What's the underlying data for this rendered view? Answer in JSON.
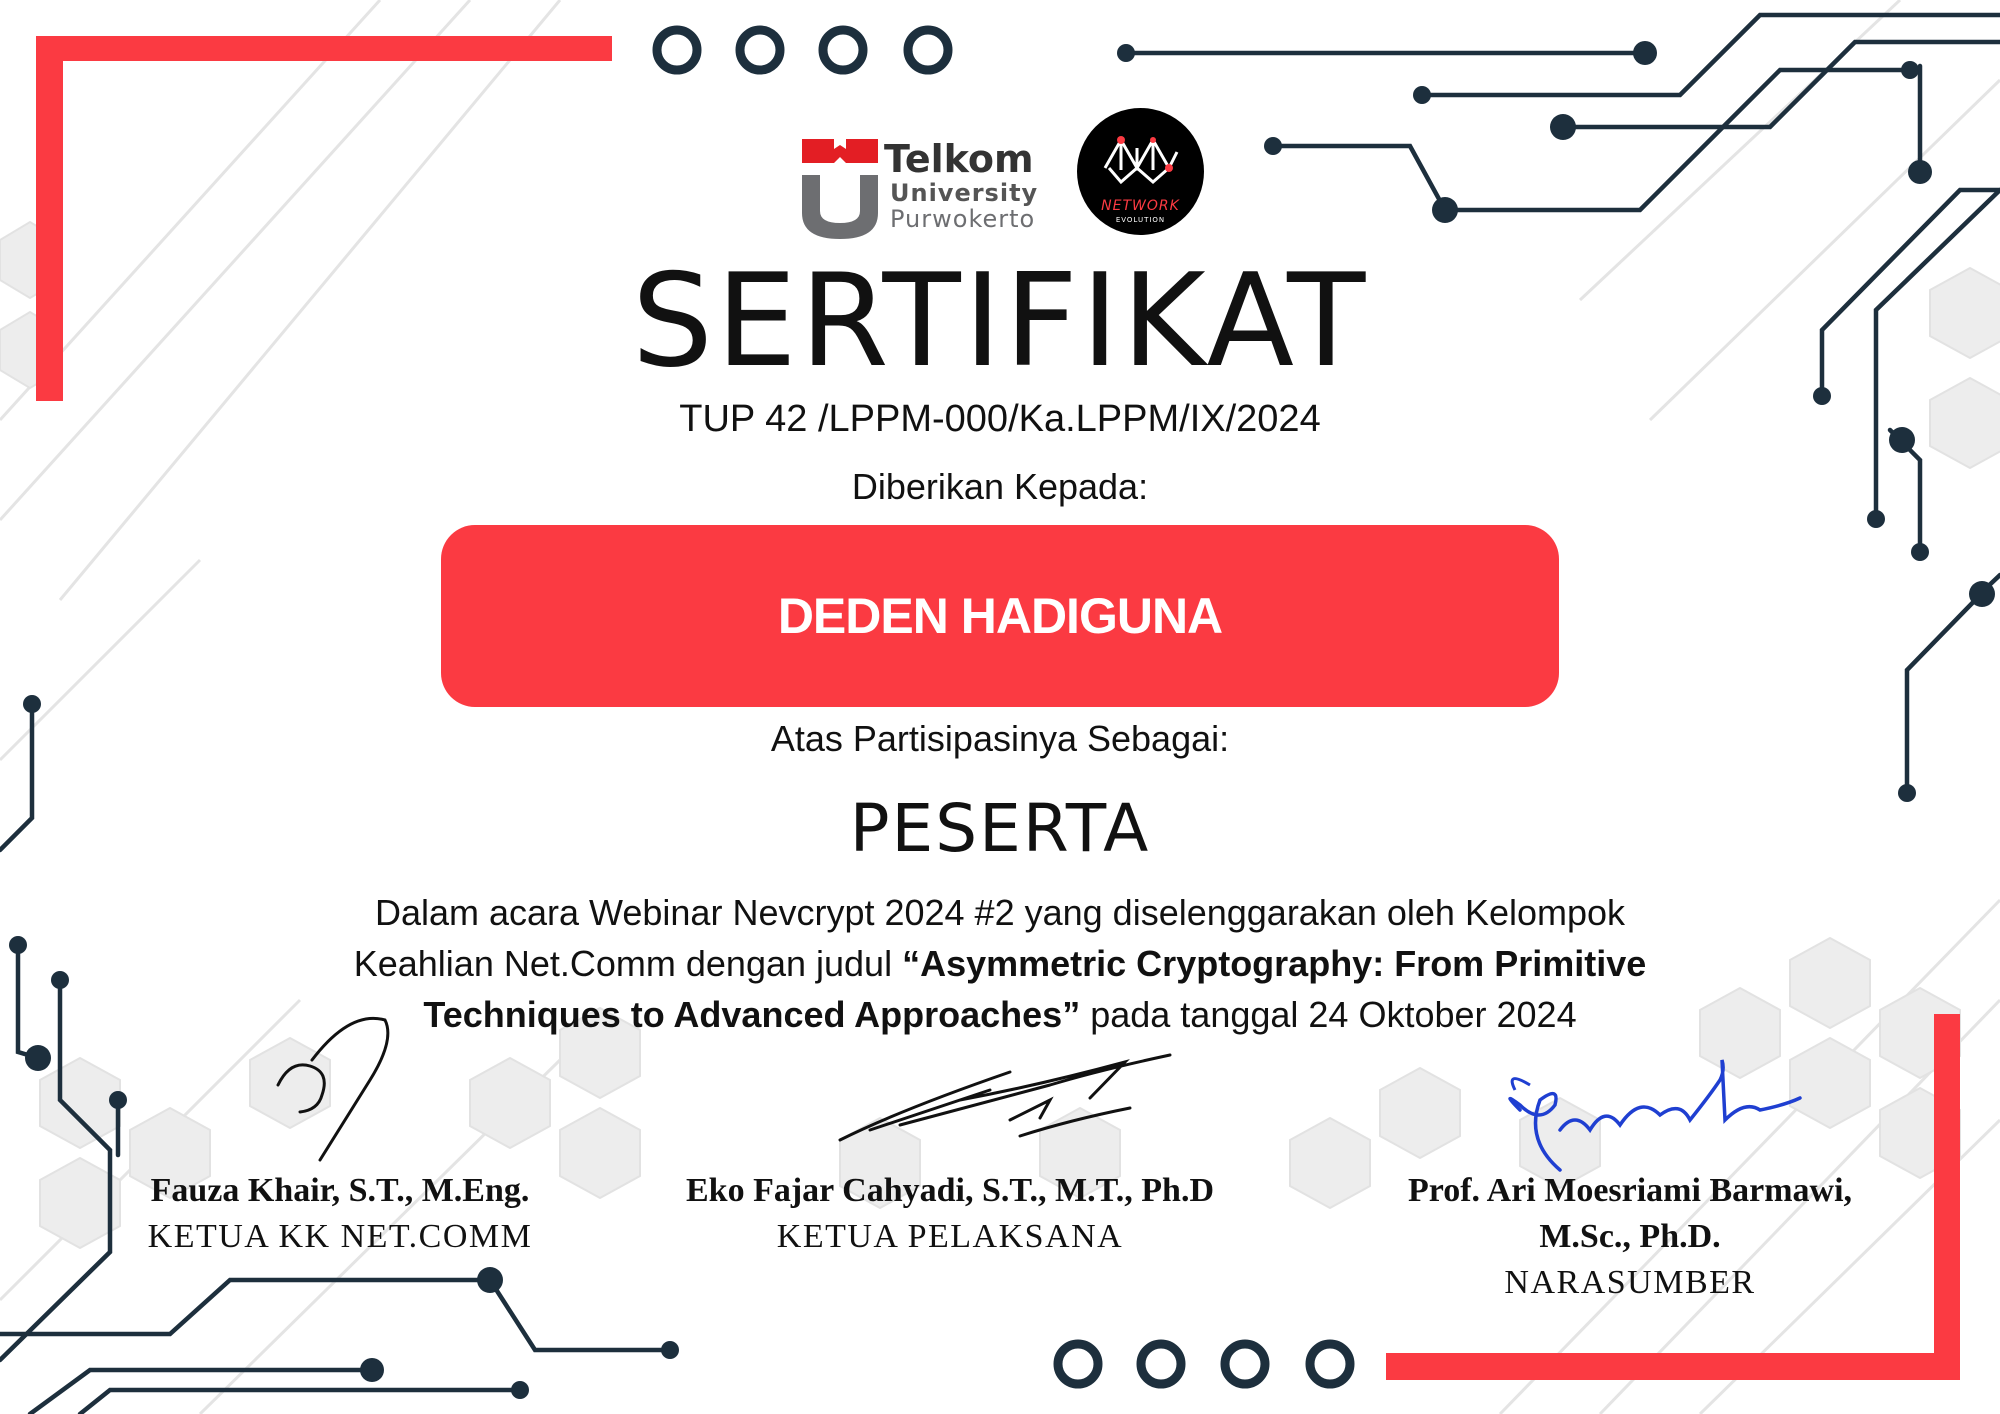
{
  "header": {
    "institution_logo_text": [
      "Telkom",
      "University",
      "Purwokerto"
    ],
    "partner_logo_text": [
      "NETWORK",
      "EVOLUTION"
    ]
  },
  "certificate": {
    "title": "SERTIFIKAT",
    "number": "TUP 42 /LPPM-000/Ka.LPPM/IX/2024",
    "given_to_label": "Diberikan Kepada:",
    "recipient_name": "DEDEN HADIGUNA",
    "participation_label": "Atas Partisipasinya Sebagai:",
    "role": "PESERTA",
    "description": {
      "line1": "Dalam acara Webinar Nevcrypt 2024 #2 yang diselenggarakan oleh Kelompok",
      "line2_prefix": "Keahlian Net.Comm dengan judul ",
      "title_part1": "“Asymmetric Cryptography: From Primitive",
      "title_part2": "Techniques to Advanced Approaches”",
      "line3_suffix": " pada tanggal 24 Oktober 2024"
    }
  },
  "signatories": [
    {
      "name": "Fauza Khair, S.T., M.Eng.",
      "position": "KETUA KK NET.COMM"
    },
    {
      "name": "Eko Fajar Cahyadi, S.T., M.T., Ph.D",
      "position": "KETUA PELAKSANA"
    },
    {
      "name_line1": "Prof. Ari Moesriami Barmawi,",
      "name_line2": "M.Sc., Ph.D.",
      "position": "NARASUMBER"
    }
  ],
  "colors": {
    "accent_red": "#fb3a42",
    "circuit": "#1d2f3d",
    "text": "#111111",
    "signature_blue": "#1f3fd1"
  }
}
